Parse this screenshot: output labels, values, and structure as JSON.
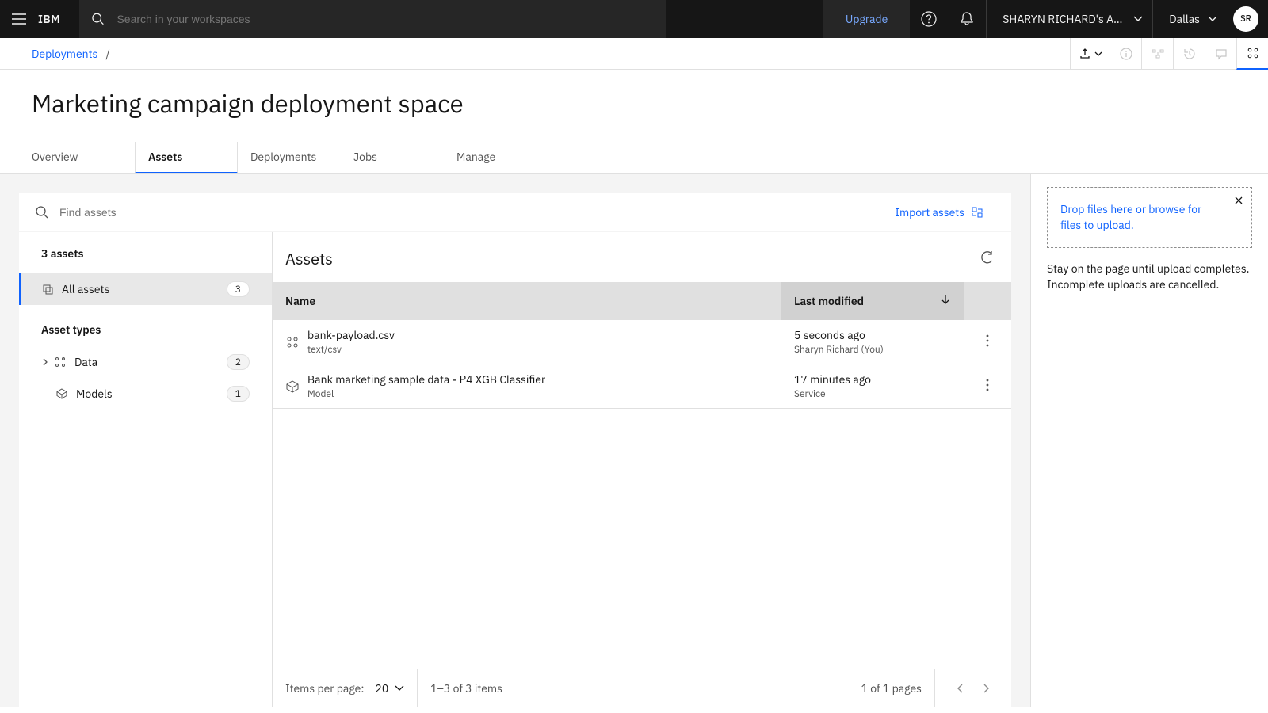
{
  "header": {
    "brand": "IBM",
    "search_placeholder": "Search in your workspaces",
    "upgrade": "Upgrade",
    "account": "SHARYN RICHARD's Accou...",
    "region": "Dallas",
    "avatar_initials": "SR"
  },
  "breadcrumb": {
    "root": "Deployments"
  },
  "title": "Marketing campaign deployment space",
  "tabs": {
    "overview": "Overview",
    "assets": "Assets",
    "deployments": "Deployments",
    "jobs": "Jobs",
    "manage": "Manage"
  },
  "find": {
    "placeholder": "Find assets",
    "import_label": "Import assets"
  },
  "side": {
    "count_header": "3 assets",
    "all_assets": "All assets",
    "all_assets_count": "3",
    "asset_types_header": "Asset types",
    "data": "Data",
    "data_count": "2",
    "models": "Models",
    "models_count": "1"
  },
  "assets": {
    "heading": "Assets",
    "col_name": "Name",
    "col_modified": "Last modified",
    "rows": [
      {
        "name": "bank-payload.csv",
        "subtype": "text/csv",
        "modified": "5 seconds ago",
        "by": "Sharyn Richard (You)",
        "icon": "data"
      },
      {
        "name": "Bank marketing sample data - P4 XGB Classifier",
        "subtype": "Model",
        "modified": "17 minutes ago",
        "by": "Service",
        "icon": "model"
      }
    ]
  },
  "pagination": {
    "items_per_page": "Items per page:",
    "per_value": "20",
    "range": "1–3 of 3 items",
    "page_of": "1 of 1 pages"
  },
  "upload_panel": {
    "dropzone": "Drop files here or browse for files to upload.",
    "hint": "Stay on the page until upload completes. Incomplete uploads are cancelled."
  }
}
